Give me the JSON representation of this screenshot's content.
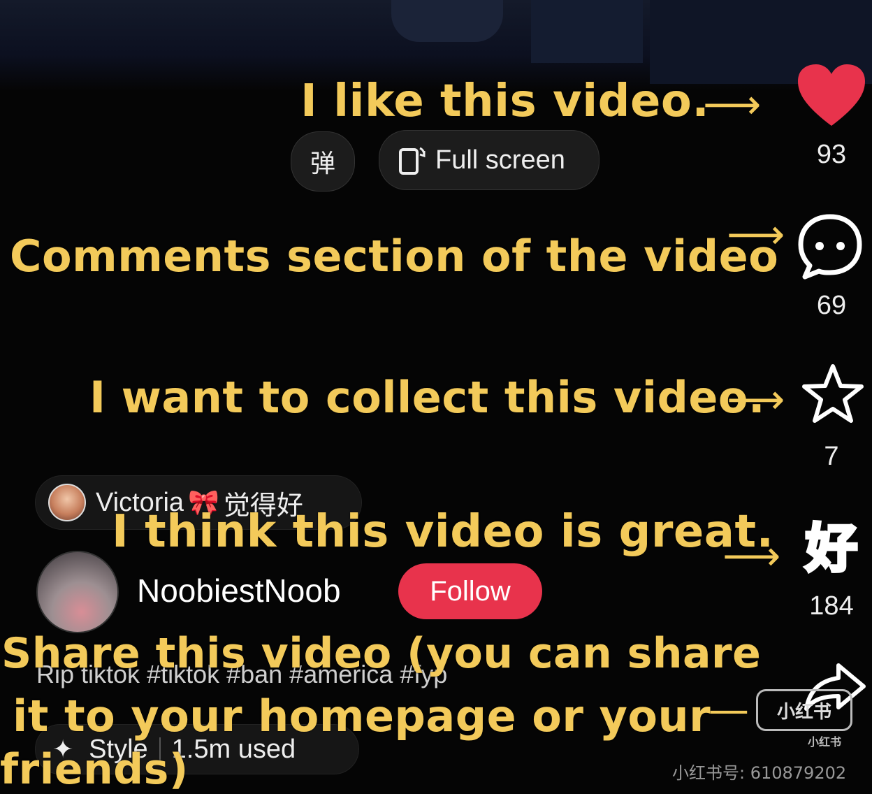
{
  "annotations": {
    "like": "I like this video.",
    "comments": "Comments section of the video",
    "collect": "I want to collect this video.",
    "great": "I think this video is great.",
    "share_line1": "Share this video (you can share",
    "share_line2": "it to your homepage or your",
    "share_line3": "friends)"
  },
  "controls": {
    "danmaku_label": "弹",
    "fullscreen_label": "Full screen"
  },
  "actions": {
    "likes": "93",
    "comments": "69",
    "collects": "7",
    "great": "184"
  },
  "reaction": {
    "user": "Victoria",
    "text": "觉得好"
  },
  "author": {
    "name": "NoobiestNoob",
    "follow_label": "Follow"
  },
  "post": {
    "caption": "Rip tiktok #tiktok  #ban  #america  #fyp",
    "style_label": "Style",
    "style_usage": "1.5m used"
  },
  "watermark": {
    "brand": "小红书",
    "id_text": "小红书号: 610879202"
  },
  "colors": {
    "annotation": "#f3ca5a",
    "like_heart": "#e8334c",
    "follow_button": "#e8334c",
    "background": "#050505"
  },
  "icons": {
    "like": "heart-icon",
    "comment": "chat-bubble-icon",
    "collect": "star-icon",
    "great": "hao-badge-icon",
    "share": "share-arrow-icon",
    "fullscreen": "rotate-screen-icon",
    "style": "sparkle-icon"
  }
}
